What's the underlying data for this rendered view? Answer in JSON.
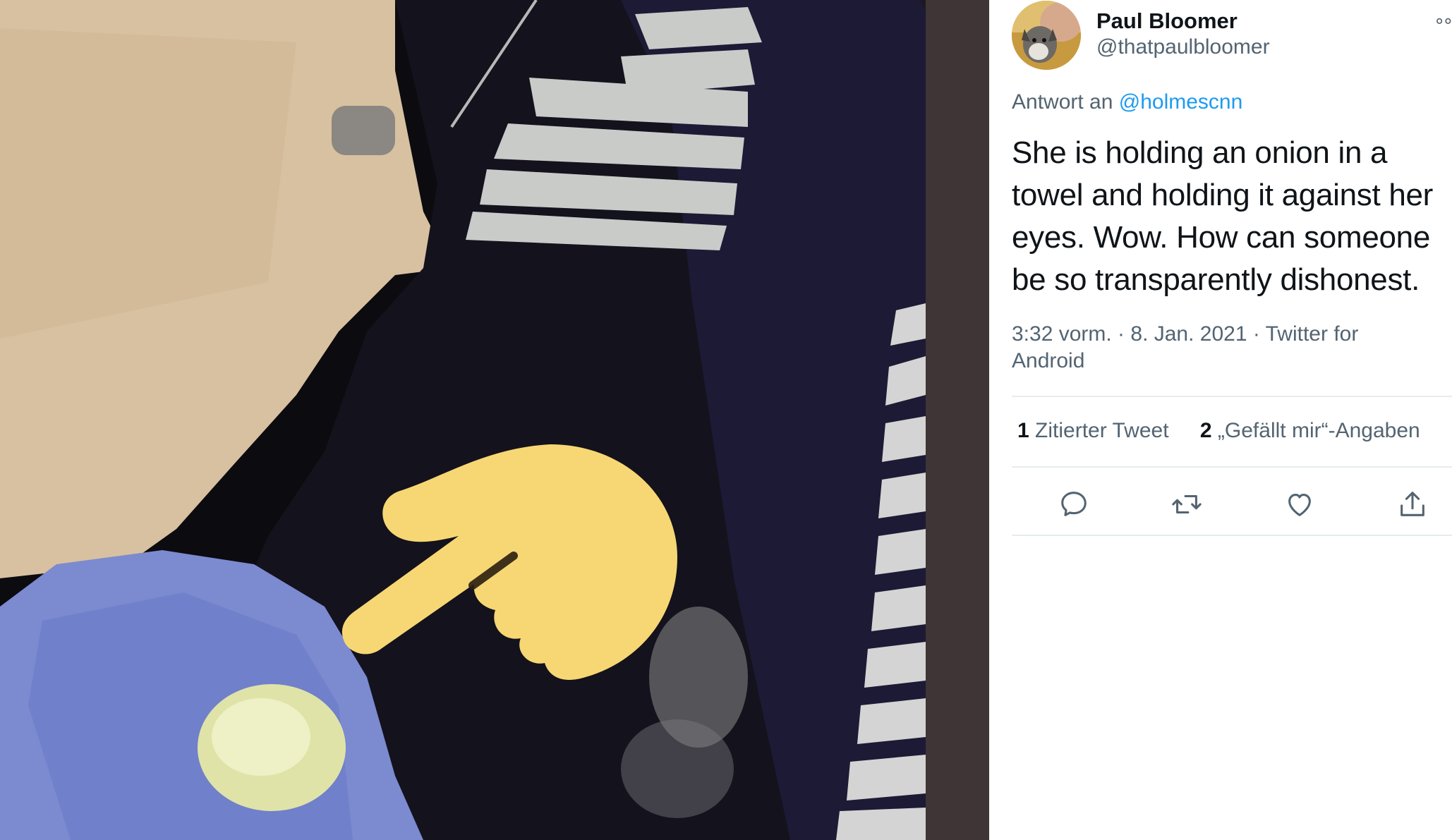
{
  "media": {
    "nav_icon": "chevron-right-double-icon",
    "nav_glyph": "»",
    "overlay_icon": "backhand-index-pointing-emoji"
  },
  "tweet": {
    "author": {
      "display_name": "Paul Bloomer",
      "handle": "@thatpaulbloomer",
      "avatar_icon": "avatar-dog-photo"
    },
    "more_glyph": "∘∘",
    "reply": {
      "prefix": "Antwort an",
      "mention": "@holmescnn"
    },
    "text": "She is holding an onion in a towel and holding it against her eyes. Wow. How can someone be so transparently dishonest.",
    "meta": "3:32 vorm. · 8. Jan. 2021 · Twitter for Android",
    "stats": {
      "quotes_count": "1",
      "quotes_label": "Zitierter Tweet",
      "likes_count": "2",
      "likes_label": "„Gefällt mir“-Angaben"
    },
    "actions": [
      {
        "icon": "reply-icon"
      },
      {
        "icon": "retweet-icon"
      },
      {
        "icon": "like-icon"
      },
      {
        "icon": "share-icon"
      }
    ],
    "colors": {
      "accent": "#1d9bf0",
      "text": "#0f1419",
      "secondary": "#536471",
      "emoji": "#f7d774"
    }
  }
}
